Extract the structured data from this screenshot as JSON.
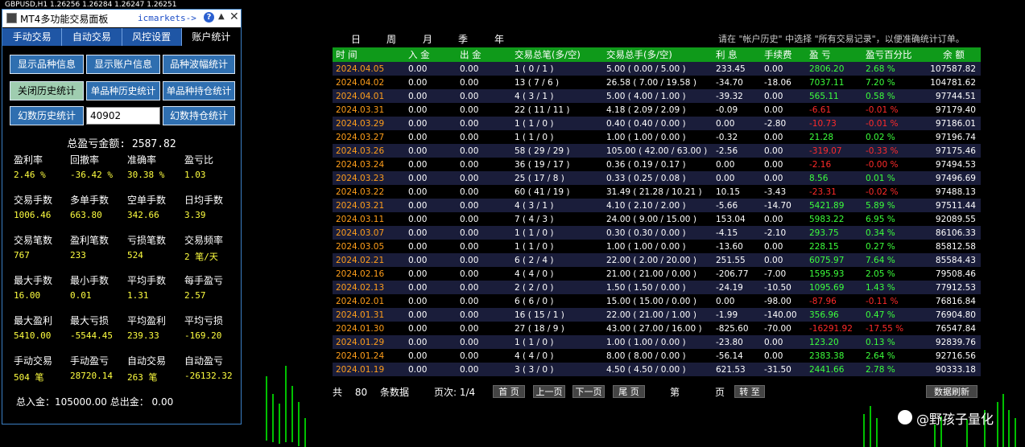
{
  "chart_header": "GBPUSD,H1  1.26256 1.26284 1.26247 1.26251",
  "panel": {
    "title": "MT4多功能交易面板",
    "broker": "icmarkets->",
    "tabs": [
      "手动交易",
      "自动交易",
      "风控设置",
      "账户统计"
    ],
    "buttons": {
      "show_symbol_info": "显示品种信息",
      "show_account_info": "显示账户信息",
      "symbol_range_stats": "品种波幅统计",
      "close_history_stats": "关闭历史统计",
      "single_symbol_history": "单品种历史统计",
      "single_symbol_position": "单品种持仓统计",
      "magic_history_stats": "幻数历史统计",
      "magic_input_value": "40902",
      "magic_position_stats": "幻数持仓统计"
    },
    "total_label": "总盈亏金额:",
    "total_value": "2587.82",
    "stats": [
      [
        {
          "label": "盈利率",
          "value": "2.46 %"
        },
        {
          "label": "回撤率",
          "value": "-36.42 %"
        },
        {
          "label": "准确率",
          "value": "30.38 %"
        },
        {
          "label": "盈亏比",
          "value": "1.03"
        }
      ],
      [
        {
          "label": "交易手数",
          "value": "1006.46"
        },
        {
          "label": "多单手数",
          "value": "663.80"
        },
        {
          "label": "空单手数",
          "value": "342.66"
        },
        {
          "label": "日均手数",
          "value": "3.39"
        }
      ],
      [
        {
          "label": "交易笔数",
          "value": "767"
        },
        {
          "label": "盈利笔数",
          "value": "233"
        },
        {
          "label": "亏损笔数",
          "value": "524"
        },
        {
          "label": "交易频率",
          "value": "2 笔/天"
        }
      ],
      [
        {
          "label": "最大手数",
          "value": "16.00"
        },
        {
          "label": "最小手数",
          "value": "0.01"
        },
        {
          "label": "平均手数",
          "value": "1.31"
        },
        {
          "label": "每手盈亏",
          "value": "2.57"
        }
      ],
      [
        {
          "label": "最大盈利",
          "value": "5410.00"
        },
        {
          "label": "最大亏损",
          "value": "-5544.45"
        },
        {
          "label": "平均盈利",
          "value": "239.33"
        },
        {
          "label": "平均亏损",
          "value": "-169.20"
        }
      ],
      [
        {
          "label": "手动交易",
          "value": "504 笔"
        },
        {
          "label": "手动盈亏",
          "value": "28720.14"
        },
        {
          "label": "自动交易",
          "value": "263 笔"
        },
        {
          "label": "自动盈亏",
          "value": "-26132.32"
        }
      ]
    ],
    "footer": "总入金：105000.00 总出金：  0.00"
  },
  "period_tabs": [
    "日",
    "周",
    "月",
    "季",
    "年"
  ],
  "hint": "请在 \"帐户历史\" 中选择 \"所有交易记录\"，以便准确统计订单。",
  "table": {
    "headers": [
      "时 间",
      "入 金",
      "出 金",
      "交易总笔(多/空)",
      "交易总手(多/空)",
      "利 息",
      "手续费",
      "盈 亏",
      "盈亏百分比",
      "余 额"
    ],
    "rows": [
      [
        "2024.04.05",
        "0.00",
        "0.00",
        "1  ( 0 / 1 )",
        "5.00  ( 0.00 / 5.00 )",
        "233.45",
        "0.00",
        "2806.20",
        "2.68 %",
        "107587.82"
      ],
      [
        "2024.04.02",
        "0.00",
        "0.00",
        "13  ( 7 / 6 )",
        "26.58  ( 7.00 / 19.58 )",
        "-34.70",
        "-18.06",
        "7037.11",
        "7.20 %",
        "104781.62"
      ],
      [
        "2024.04.01",
        "0.00",
        "0.00",
        "4  ( 3 / 1 )",
        "5.00  ( 4.00 / 1.00 )",
        "-39.32",
        "0.00",
        "565.11",
        "0.58 %",
        "97744.51"
      ],
      [
        "2024.03.31",
        "0.00",
        "0.00",
        "22  ( 11 / 11 )",
        "4.18  ( 2.09 / 2.09 )",
        "-0.09",
        "0.00",
        "-6.61",
        "-0.01 %",
        "97179.40"
      ],
      [
        "2024.03.29",
        "0.00",
        "0.00",
        "1  ( 1 / 0 )",
        "0.40  ( 0.40 / 0.00 )",
        "0.00",
        "-2.80",
        "-10.73",
        "-0.01 %",
        "97186.01"
      ],
      [
        "2024.03.27",
        "0.00",
        "0.00",
        "1  ( 1 / 0 )",
        "1.00  ( 1.00 / 0.00 )",
        "-0.32",
        "0.00",
        "21.28",
        "0.02 %",
        "97196.74"
      ],
      [
        "2024.03.26",
        "0.00",
        "0.00",
        "58  ( 29 / 29 )",
        "105.00  ( 42.00 / 63.00 )",
        "-2.56",
        "0.00",
        "-319.07",
        "-0.33 %",
        "97175.46"
      ],
      [
        "2024.03.24",
        "0.00",
        "0.00",
        "36  ( 19 / 17 )",
        "0.36  ( 0.19 / 0.17 )",
        "0.00",
        "0.00",
        "-2.16",
        "-0.00 %",
        "97494.53"
      ],
      [
        "2024.03.23",
        "0.00",
        "0.00",
        "25  ( 17 / 8 )",
        "0.33  ( 0.25 / 0.08 )",
        "0.00",
        "0.00",
        "8.56",
        "0.01 %",
        "97496.69"
      ],
      [
        "2024.03.22",
        "0.00",
        "0.00",
        "60  ( 41 / 19 )",
        "31.49  ( 21.28 / 10.21 )",
        "10.15",
        "-3.43",
        "-23.31",
        "-0.02 %",
        "97488.13"
      ],
      [
        "2024.03.21",
        "0.00",
        "0.00",
        "4  ( 3 / 1 )",
        "4.10  ( 2.10 / 2.00 )",
        "-5.66",
        "-14.70",
        "5421.89",
        "5.89 %",
        "97511.44"
      ],
      [
        "2024.03.11",
        "0.00",
        "0.00",
        "7  ( 4 / 3 )",
        "24.00  ( 9.00 / 15.00 )",
        "153.04",
        "0.00",
        "5983.22",
        "6.95 %",
        "92089.55"
      ],
      [
        "2024.03.07",
        "0.00",
        "0.00",
        "1  ( 1 / 0 )",
        "0.30  ( 0.30 / 0.00 )",
        "-4.15",
        "-2.10",
        "293.75",
        "0.34 %",
        "86106.33"
      ],
      [
        "2024.03.05",
        "0.00",
        "0.00",
        "1  ( 1 / 0 )",
        "1.00  ( 1.00 / 0.00 )",
        "-13.60",
        "0.00",
        "228.15",
        "0.27 %",
        "85812.58"
      ],
      [
        "2024.02.21",
        "0.00",
        "0.00",
        "6  ( 2 / 4 )",
        "22.00  ( 2.00 / 20.00 )",
        "251.55",
        "0.00",
        "6075.97",
        "7.64 %",
        "85584.43"
      ],
      [
        "2024.02.16",
        "0.00",
        "0.00",
        "4  ( 4 / 0 )",
        "21.00  ( 21.00 / 0.00 )",
        "-206.77",
        "-7.00",
        "1595.93",
        "2.05 %",
        "79508.46"
      ],
      [
        "2024.02.13",
        "0.00",
        "0.00",
        "2  ( 2 / 0 )",
        "1.50  ( 1.50 / 0.00 )",
        "-24.19",
        "-10.50",
        "1095.69",
        "1.43 %",
        "77912.53"
      ],
      [
        "2024.02.01",
        "0.00",
        "0.00",
        "6  ( 6 / 0 )",
        "15.00  ( 15.00 / 0.00 )",
        "0.00",
        "-98.00",
        "-87.96",
        "-0.11 %",
        "76816.84"
      ],
      [
        "2024.01.31",
        "0.00",
        "0.00",
        "16  ( 15 / 1 )",
        "22.00  ( 21.00 / 1.00 )",
        "-1.99",
        "-140.00",
        "356.96",
        "0.47 %",
        "76904.80"
      ],
      [
        "2024.01.30",
        "0.00",
        "0.00",
        "27  ( 18 / 9 )",
        "43.00  ( 27.00 / 16.00 )",
        "-825.60",
        "-70.00",
        "-16291.92",
        "-17.55 %",
        "76547.84"
      ],
      [
        "2024.01.29",
        "0.00",
        "0.00",
        "1  ( 1 / 0 )",
        "1.00  ( 1.00 / 0.00 )",
        "-23.80",
        "0.00",
        "123.20",
        "0.13 %",
        "92839.76"
      ],
      [
        "2024.01.24",
        "0.00",
        "0.00",
        "4  ( 4 / 0 )",
        "8.00  ( 8.00 / 0.00 )",
        "-56.14",
        "0.00",
        "2383.38",
        "2.64 %",
        "92716.56"
      ],
      [
        "2024.01.19",
        "0.00",
        "0.00",
        "3  ( 3 / 0 )",
        "4.50  ( 4.50 / 0.00 )",
        "621.53",
        "-31.50",
        "2441.66",
        "2.78 %",
        "90333.18"
      ]
    ]
  },
  "pager": {
    "total_prefix": "共",
    "total_count": "80",
    "total_suffix": "条数据",
    "page_label": "页次: 1/4",
    "first": "首 页",
    "prev": "上一页",
    "next": "下一页",
    "last": "尾 页",
    "goto_prefix": "第",
    "goto_suffix": "页",
    "goto_button": "转 至",
    "refresh": "数据刷新"
  },
  "watermark": "@野孩子量化"
}
